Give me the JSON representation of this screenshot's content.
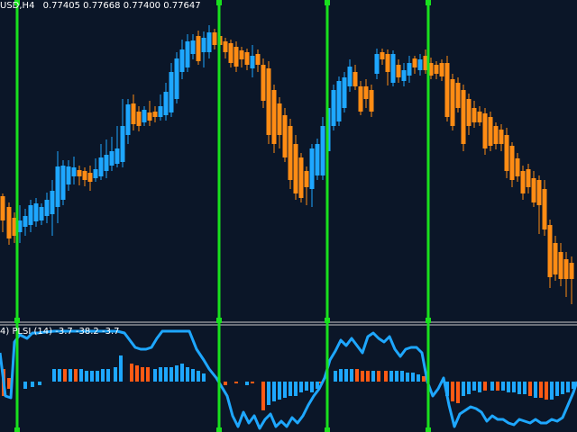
{
  "header": {
    "symbol_timeframe": "USD,H4",
    "ohlc": "0.77405 0.77668 0.77400 0.77647"
  },
  "indicator": {
    "label": "4) PLSI (14) -3.7 -38.2 -3.7"
  },
  "colors": {
    "background": "#0b1628",
    "bull": "#1ea7ff",
    "bear": "#ff8c14",
    "marker_line": "#19e01e",
    "indicator_line": "#1ea7ff",
    "hist_pos": "#1ea7ff",
    "hist_neg": "#ff5a14",
    "separator": "#c8c8c8"
  }
}
